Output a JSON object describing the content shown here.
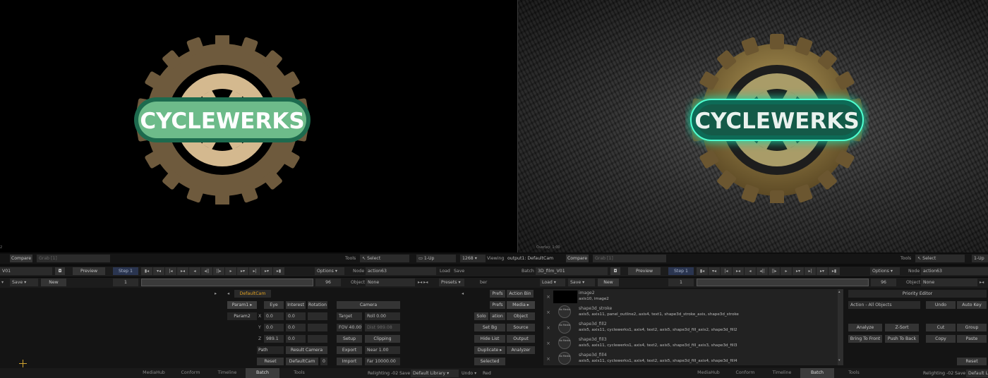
{
  "colors": {
    "accent_orange": "#e0a020",
    "blue_button": "#2a3550",
    "panel_bg": "#1c1c1c",
    "logo_green": "#6dbb8a",
    "glow_teal": "#1fd6a4",
    "gear_tan": "#6e5a3d",
    "gear_light": "#d4b98f"
  },
  "viewport_left": {
    "logo_text": "CYCLEWERKS",
    "info": "",
    "corner": "2"
  },
  "viewport_right": {
    "logo_text": "CYCLEWERKS",
    "info": "Overlay: 1:00"
  },
  "top_bar": {
    "compare": "Compare",
    "grab": "Grab [1]",
    "tools": "Tools",
    "select": "Select",
    "layout": "1-Up",
    "zoom": "1268",
    "viewing_label": "Viewing",
    "viewing_value": "output1: DefaultCam",
    "compare_r": "Compare",
    "grab_r": "Grab [1]",
    "tools_r": "Tools",
    "select_r": "Select",
    "layout_r": "1-Up"
  },
  "batch_bar": {
    "batch_name_l": "V01",
    "preview": "Preview",
    "step": "Step 1",
    "options": "Options",
    "node_label": "Node",
    "node_value": "action63",
    "load": "Load",
    "save": "Save",
    "batch_label": "Batch",
    "batch_value": "3D_film_V01",
    "preview_r": "Preview",
    "step_r": "Step 1",
    "options_r": "Options",
    "node_label_r": "Node",
    "node_value_r": "action63"
  },
  "frame_bar": {
    "save": "Save",
    "new": "New",
    "frame": "1",
    "end": "96",
    "object_label": "Object",
    "object_value": "None",
    "presets": "Presets",
    "ber": "ber",
    "load_r": "Load",
    "save_r": "Save",
    "new_r": "New",
    "frame_r": "1",
    "end_r": "96",
    "object_label_r": "Object",
    "object_value_r": "None"
  },
  "camera_panel": {
    "camera_name": "DefaultCam",
    "param1": "Param1",
    "param2": "Param2",
    "col_eye": "Eye",
    "col_interest": "Interest",
    "col_rotation": "Rotation",
    "x_label": "X",
    "y_label": "Y",
    "z_label": "Z",
    "x_vals": [
      "0.0",
      "0.0",
      ""
    ],
    "y_vals": [
      "0.0",
      "0.0",
      ""
    ],
    "z_vals": [
      "989.1",
      "0.0",
      ""
    ],
    "path": "Path",
    "result_camera": "Result Camera",
    "reset": "Reset",
    "defaultcam": "DefaultCam",
    "zero": "0",
    "camera_header": "Camera",
    "target": "Target",
    "roll": "Roll 0.00",
    "fov": "FOV 40.00°",
    "dist": "Dist 989.08",
    "setup": "Setup",
    "clipping": "Clipping",
    "export": "Export",
    "near": "Near 1.00",
    "import": "Import",
    "far": "Far 10000.00"
  },
  "mid_buttons": {
    "prefs_a": "Prefs",
    "action_bin": "Action Bin",
    "prefs_b": "Prefs",
    "media": "Media",
    "solo": "Solo",
    "ation": "ation",
    "object": "Object",
    "set_bg": "Set Bg",
    "source": "Source",
    "hide_list": "Hide List",
    "output": "Output",
    "duplicate": "Duplicate",
    "analyzer": "Analyzer",
    "selected": "Selected"
  },
  "media_list": [
    {
      "check": "×",
      "title": "image2",
      "axes": "axis10, image2",
      "thumb": "black"
    },
    {
      "check": "×",
      "title": "shape3d_stroke",
      "axes": "axis5, axis11, panel_outline2, axis4, text1, shape3d_stroke_axis, shape3d_stroke",
      "thumb": "No Media"
    },
    {
      "check": "×",
      "title": "shape3d_fill2",
      "axes": "axis5, axis11, cyclewerks1, axis4, text2, axis5, shape3d_fill_axis2, shape3d_fill2",
      "thumb": "No Media"
    },
    {
      "check": "×",
      "title": "shape3d_fill3",
      "axes": "axis5, axis11, cyclewerks1, axis4, text2, axis5, shape3d_fill_axis3, shape3d_fill3",
      "thumb": "No Media"
    },
    {
      "check": "×",
      "title": "shape3d_fill4",
      "axes": "axis5, axis11, cyclewerks1, axis4, text2, axis5, shape3d_fill_axis4, shape3d_fill4",
      "thumb": "No Media"
    }
  ],
  "priority_panel": {
    "header": "Priority Editor",
    "filter": "Action - All Objects",
    "undo": "Undo",
    "auto_key": "Auto Key",
    "analyze": "Analyze",
    "z_sort": "Z-Sort",
    "cut": "Cut",
    "group": "Group",
    "bring_to_front": "Bring To Front",
    "push_to_back": "Push To Back",
    "copy": "Copy",
    "paste": "Paste",
    "reset": "Reset"
  },
  "tabs_left": [
    "MediaHub",
    "Conform",
    "Timeline",
    "Batch",
    "Tools"
  ],
  "tabs_right": [
    "MediaHub",
    "Conform",
    "Timeline",
    "Batch",
    "Tools"
  ],
  "status_bar": {
    "relighting": "Relighting -02",
    "save": "Save",
    "library": "Default Library",
    "undo": "Undo",
    "redo": "Red",
    "relighting_r": "Relighting -02",
    "save_r": "Save",
    "library_r": "Default Lib"
  }
}
